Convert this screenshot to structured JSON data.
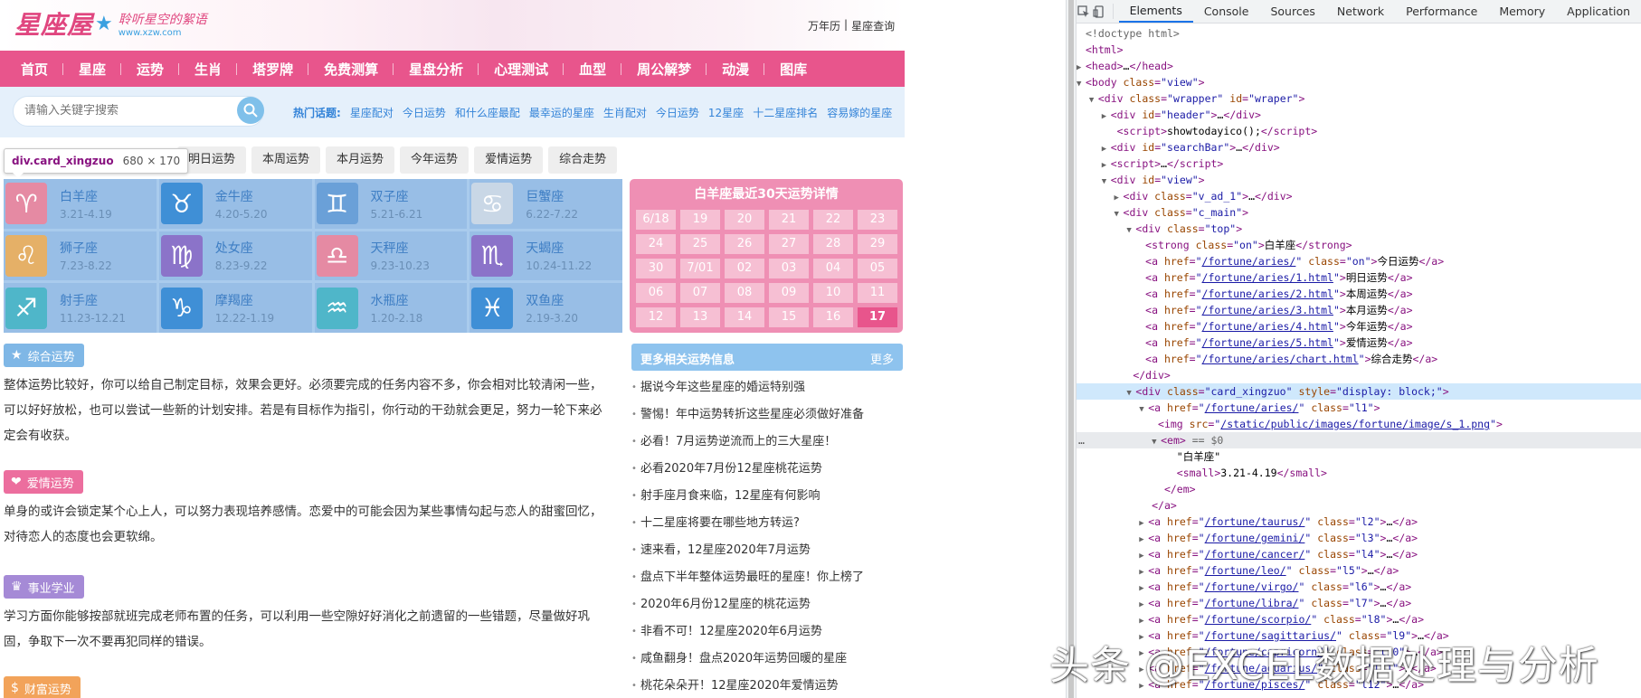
{
  "site": {
    "logo_text": "星座屋",
    "slogan": "聆听星空的絮语",
    "domain_url": "www.xzw.com",
    "top_links": [
      "万年历",
      "|",
      "星座查询"
    ],
    "nav": [
      "首页",
      "星座",
      "运势",
      "生肖",
      "塔罗牌",
      "免费测算",
      "星盘分析",
      "心理测试",
      "血型",
      "周公解梦",
      "动漫",
      "图库"
    ],
    "search": {
      "placeholder": "请输入关键字搜索"
    },
    "hot_label": "热门话题:",
    "hot_topics": [
      "星座配对",
      "今日运势",
      "和什么座最配",
      "最幸运的星座",
      "生肖配对",
      "今日运势",
      "12星座",
      "十二星座排名",
      "容易嫁的星座"
    ],
    "tooltip": {
      "name": "div.card_xingzuo",
      "size": "680 × 170"
    },
    "tabs": [
      "明日运势",
      "本周运势",
      "本月运势",
      "今年运势",
      "爱情运势",
      "综合走势"
    ],
    "zodiac": [
      {
        "name": "白羊座",
        "date": "3.21-4.19",
        "symbol": "♈"
      },
      {
        "name": "金牛座",
        "date": "4.20-5.20",
        "symbol": "♉"
      },
      {
        "name": "双子座",
        "date": "5.21-6.21",
        "symbol": "♊"
      },
      {
        "name": "巨蟹座",
        "date": "6.22-7.22",
        "symbol": "♋"
      },
      {
        "name": "狮子座",
        "date": "7.23-8.22",
        "symbol": "♌"
      },
      {
        "name": "处女座",
        "date": "8.23-9.22",
        "symbol": "♍"
      },
      {
        "name": "天秤座",
        "date": "9.23-10.23",
        "symbol": "♎"
      },
      {
        "name": "天蝎座",
        "date": "10.24-11.22",
        "symbol": "♏"
      },
      {
        "name": "射手座",
        "date": "11.23-12.21",
        "symbol": "♐"
      },
      {
        "name": "摩羯座",
        "date": "12.22-1.19",
        "symbol": "♑"
      },
      {
        "name": "水瓶座",
        "date": "1.20-2.18",
        "symbol": "♒"
      },
      {
        "name": "双鱼座",
        "date": "2.19-3.20",
        "symbol": "♓"
      }
    ],
    "zodiac_colors": [
      "#e58aa3",
      "#3f8fd6",
      "#6aa0d8",
      "#c9d7e6",
      "#e5b067",
      "#8b73c9",
      "#e58aa3",
      "#8b73c9",
      "#4fb6c9",
      "#3f8fd6",
      "#4fb6c9",
      "#3f8fd6"
    ],
    "calendar": {
      "title": "白羊座最近30天运势详情",
      "days": [
        "6/18",
        "19",
        "20",
        "21",
        "22",
        "23",
        "24",
        "25",
        "26",
        "27",
        "28",
        "29",
        "30",
        "7/01",
        "02",
        "03",
        "04",
        "05",
        "06",
        "07",
        "08",
        "09",
        "10",
        "11",
        "12",
        "13",
        "14",
        "15",
        "16",
        "17"
      ],
      "today": "17"
    },
    "sections": [
      {
        "title": "综合运势",
        "icon": "★",
        "color": "#7fb7e6",
        "text": "整体运势比较好，你可以给自己制定目标，效果会更好。必须要完成的任务内容不多，你会相对比较清闲一些，可以好好放松，也可以尝试一些新的计划安排。若是有目标作为指引，你行动的干劲就会更足，努力一轮下来必定会有收获。"
      },
      {
        "title": "爱情运势",
        "icon": "❤",
        "color": "#ec6e9e",
        "text": "单身的或许会锁定某个心上人，可以努力表现培养感情。恋爱中的可能会因为某些事情勾起与恋人的甜蜜回忆，对待恋人的态度也会更软绵。"
      },
      {
        "title": "事业学业",
        "icon": "♛",
        "color": "#a58ad6",
        "text": "学习方面你能够按部就班完成老师布置的任务，可以利用一些空隙好好消化之前遗留的一些错题，尽量做好巩固，争取下一次不要再犯同样的错误。"
      },
      {
        "title": "财富运势",
        "icon": "$",
        "color": "#f2a35a",
        "text": ""
      }
    ],
    "more": {
      "title": "更多相关运势信息",
      "more_label": "更多",
      "items": [
        "据说今年这些星座的婚运特别强",
        "警惕！年中运势转折这些星座必须做好准备",
        "必看！7月运势逆流而上的三大星座！",
        "必看2020年7月份12星座桃花运势",
        "射手座月食来临，12星座有何影响",
        "十二星座将要在哪些地方转运?",
        "速来看，12星座2020年7月运势",
        "盘点下半年整体运势最旺的星座！你上榜了",
        "2020年6月份12星座的桃花运势",
        "非看不可！12星座2020年6月运势",
        "咸鱼翻身！盘点2020年运势回暖的星座",
        "桃花朵朵开！12星座2020年爱情运势"
      ]
    }
  },
  "devtools": {
    "tabs": [
      "Elements",
      "Console",
      "Sources",
      "Network",
      "Performance",
      "Memory",
      "Application"
    ],
    "active_tab": "Elements"
  },
  "watermark": "头条 @EXCEL数据处理与分析"
}
